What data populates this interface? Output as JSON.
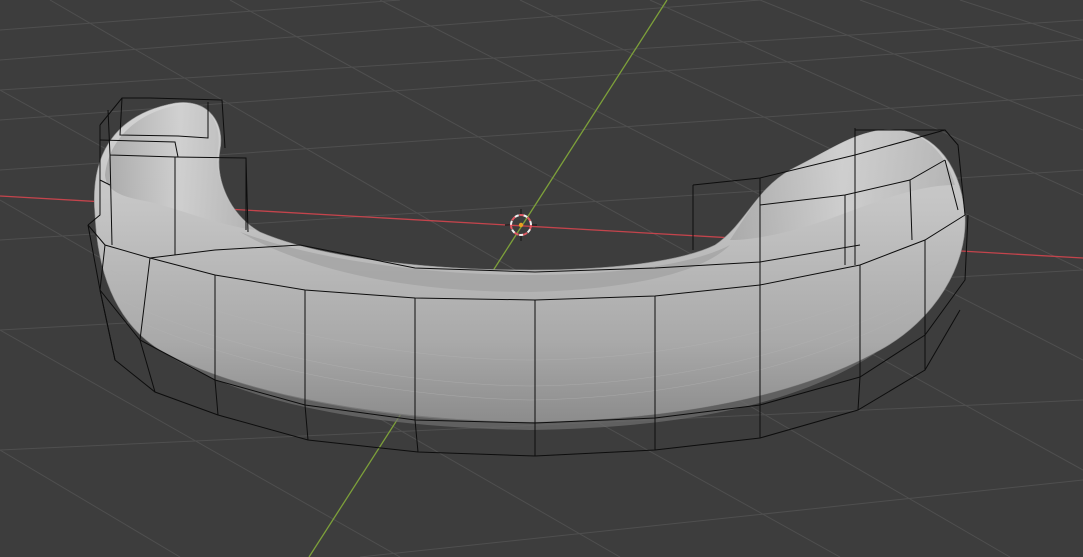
{
  "viewport": {
    "kind": "3D viewport",
    "background": "#3d3d3d",
    "grid_color": "#4f4f4f",
    "axis_x_color": "#c4444c",
    "axis_y_color": "#7da03a",
    "mesh_color": "#b9b9b9",
    "cage_color": "#0d0d0d",
    "cursor_colors": [
      "#e05a64",
      "#f0f0f0",
      "#e8a020"
    ]
  },
  "icons": {
    "cursor": "3d-cursor-icon"
  }
}
